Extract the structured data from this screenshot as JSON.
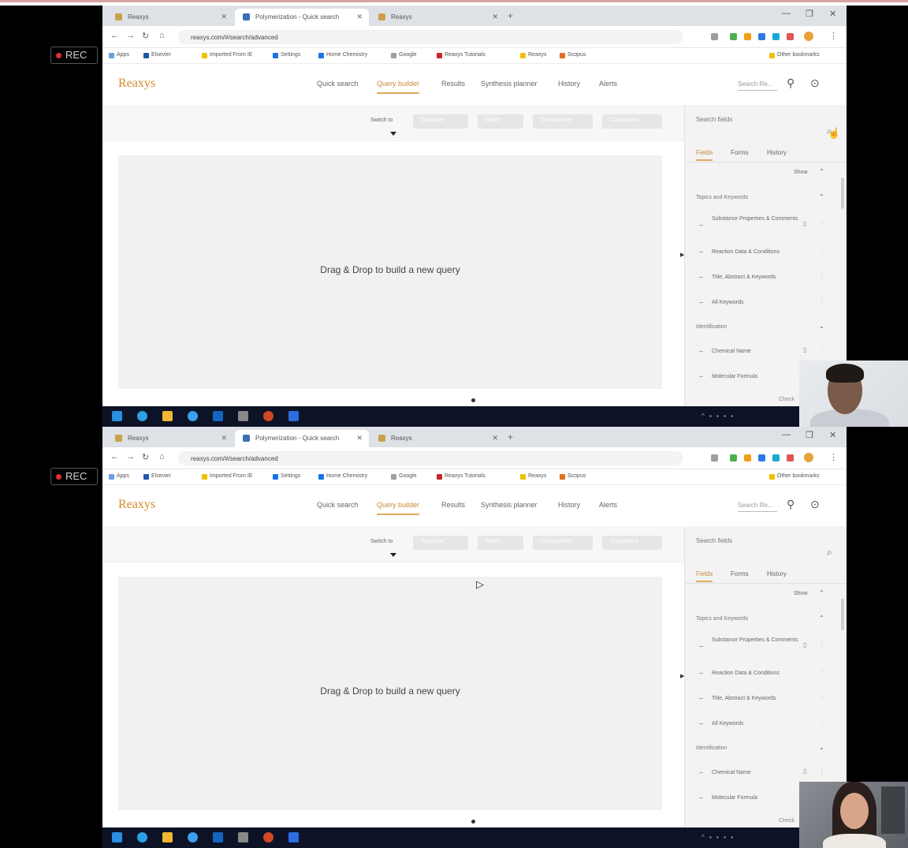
{
  "recording": {
    "label": "REC"
  },
  "browser": {
    "tabs": [
      {
        "title": "Reaxys",
        "fav": "#c8a24a"
      },
      {
        "title": "Polymerization - Quick search",
        "fav": "#3b6fb5"
      },
      {
        "title": "Reaxys",
        "fav": "#c8a24a"
      }
    ],
    "new_tab": "+",
    "url": "reaxys.com/#/search/advanced",
    "bookmarks": [
      "Apps",
      "Elsevier",
      "Imported From IE",
      "Settings",
      "Home Chemistry",
      "Google",
      "Reaxys Tutorials",
      "Reaxys",
      "Scopus",
      "Other bookmarks"
    ],
    "extension_colors": [
      "#4caf50",
      "#f39c12",
      "#2a7ae2",
      "#18a8d6",
      "#e05555",
      "#e8a23a"
    ]
  },
  "app": {
    "logo": "Reaxys",
    "nav": [
      "Quick search",
      "Query builder",
      "Results",
      "Synthesis planner",
      "History",
      "Alerts"
    ],
    "active_nav": "Query builder",
    "search_placeholder": "Search Re...",
    "toolbar": {
      "switch_label": "Switch to",
      "buttons": [
        "Structure",
        "Match",
        "Components",
        "Component"
      ]
    },
    "canvas_message": "Drag & Drop to build a new query"
  },
  "sidebar": {
    "title": "Search fields",
    "tabs": [
      "Fields",
      "Forms",
      "History"
    ],
    "active_tab": "Fields",
    "show_label": "Show",
    "groups": [
      {
        "label": "Topics and Keywords",
        "items": [
          "Substance Properties & Comments",
          "Reaction Data & Conditions",
          "Title, Abstract & Keywords",
          "All Keywords"
        ]
      },
      {
        "label": "Identification",
        "items": [
          "Chemical Name",
          "Molecular Formula"
        ]
      }
    ],
    "peek_label": "Check"
  },
  "taskbar": {
    "app_colors": [
      "#1e90ff",
      "#2aa0e6",
      "#f2b632",
      "#3aa0f0",
      "#1565c0",
      "#888888",
      "#d24726",
      "#2d6cdf"
    ],
    "tray": "^ ▪ ▪ ▪ ▪"
  }
}
